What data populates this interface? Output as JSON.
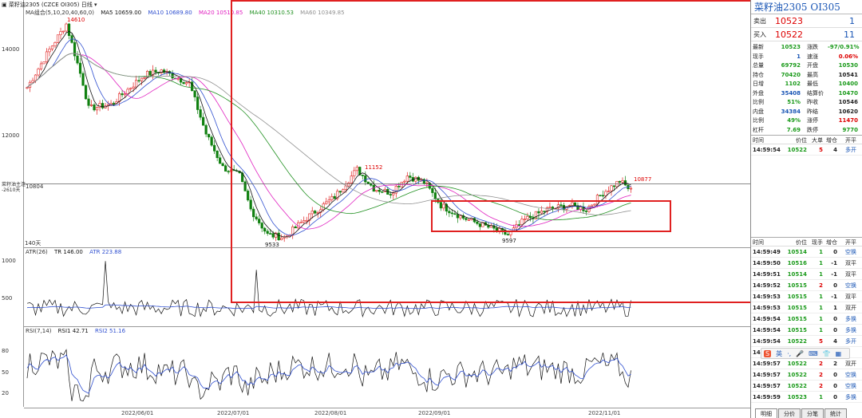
{
  "title_bar": {
    "text": "菜籽油2305 (CZCE OI305)",
    "period": "日线"
  },
  "ma_legend": {
    "label": "MA组合(5,10,20,40,60,0)",
    "ma5": "MA5 10659.00",
    "ma10": "MA10 10689.80",
    "ma20": "MA20 10510.85",
    "ma40": "MA40 10310.53",
    "ma60": "MA60 10349.85"
  },
  "colors": {
    "ma5": "#111111",
    "ma10": "#3050d0",
    "ma20": "#e020c0",
    "ma40": "#209020",
    "ma60": "#909090",
    "up": "#e02020",
    "down": "#108010",
    "box": "#e02020"
  },
  "price_axis": {
    "labels": [
      "14000",
      "12000",
      "10804"
    ],
    "cursor_label": "菜籽油主连",
    "cursor_sub": "-2610天",
    "days_label": "140天"
  },
  "annotations": {
    "high": "14610",
    "mid_high": "11152",
    "recent_high": "10877",
    "low1": "9533",
    "low2": "9597"
  },
  "atr_legend": {
    "label": "ATR(26)",
    "tr": "TR 146.00",
    "atr": "ATR 223.88",
    "axis": [
      "1000",
      "500"
    ]
  },
  "rsi_legend": {
    "label": "RSI(7,14)",
    "rsi1": "RSI1 42.71",
    "rsi2": "RSI2 51.16",
    "axis": [
      "80",
      "50",
      "20"
    ]
  },
  "dates": [
    "2022/06/01",
    "2022/07/01",
    "2022/08/01",
    "2022/09/01",
    "2022/11/01"
  ],
  "sidebar": {
    "title": "菜籽油2305  OI305",
    "sell": {
      "label": "卖出",
      "price": "10523",
      "vol": "1"
    },
    "buy": {
      "label": "买入",
      "price": "10522",
      "vol": "11"
    },
    "quote": [
      {
        "k": "最新",
        "v": "10523",
        "k2": "涨跌",
        "v2": "-97/0.91%"
      },
      {
        "k": "现手",
        "v": "1",
        "k2": "速涨",
        "v2": "0.06%"
      },
      {
        "k": "总量",
        "v": "69792",
        "k2": "开盘",
        "v2": "10530"
      },
      {
        "k": "持仓",
        "v": "70420",
        "k2": "最高",
        "v2": "10541"
      },
      {
        "k": "日增",
        "v": "1102",
        "k2": "最低",
        "v2": "10400"
      },
      {
        "k": "外盘",
        "v": "35408",
        "k2": "结算价",
        "v2": "10470"
      },
      {
        "k": "比例",
        "v": "51%",
        "k2": "昨收",
        "v2": "10546"
      },
      {
        "k": "内盘",
        "v": "34384",
        "k2": "昨结",
        "v2": "10620"
      },
      {
        "k": "比例",
        "v": "49%",
        "k2": "涨停",
        "v2": "11470"
      },
      {
        "k": "杠杆",
        "v": "7.69",
        "k2": "跌停",
        "v2": "9770"
      }
    ],
    "big_head": [
      "时间",
      "价位",
      "大单",
      "增仓",
      "开平"
    ],
    "big_rows": [
      {
        "t": "14:59:54",
        "p": "10522",
        "a": "5",
        "b": "4",
        "c": "多开"
      }
    ],
    "trade_head": [
      "时间",
      "价位",
      "现手",
      "增仓",
      "开平"
    ],
    "trades": [
      {
        "t": "14:59:49",
        "p": "10514",
        "a": "1",
        "b": "0",
        "c": "空换"
      },
      {
        "t": "14:59:50",
        "p": "10516",
        "a": "1",
        "b": "-1",
        "c": "双平"
      },
      {
        "t": "14:59:51",
        "p": "10514",
        "a": "1",
        "b": "-1",
        "c": "双平"
      },
      {
        "t": "14:59:52",
        "p": "10515",
        "a": "2",
        "b": "0",
        "c": "空换"
      },
      {
        "t": "14:59:53",
        "p": "10515",
        "a": "1",
        "b": "-1",
        "c": "双平"
      },
      {
        "t": "14:59:53",
        "p": "10515",
        "a": "1",
        "b": "1",
        "c": "双开"
      },
      {
        "t": "14:59:54",
        "p": "10515",
        "a": "1",
        "b": "0",
        "c": "多换"
      },
      {
        "t": "14:59:54",
        "p": "10515",
        "a": "1",
        "b": "0",
        "c": "多换"
      },
      {
        "t": "14:59:54",
        "p": "10522",
        "a": "5",
        "b": "4",
        "c": "多开"
      },
      {
        "t": "14:59:55",
        "p": "",
        "a": "",
        "b": "",
        "c": ""
      },
      {
        "t": "14:59:57",
        "p": "10522",
        "a": "2",
        "b": "2",
        "c": "双开"
      },
      {
        "t": "14:59:57",
        "p": "10522",
        "a": "2",
        "b": "0",
        "c": "空换"
      },
      {
        "t": "14:59:57",
        "p": "10522",
        "a": "2",
        "b": "0",
        "c": "空换"
      },
      {
        "t": "14:59:59",
        "p": "10523",
        "a": "1",
        "b": "0",
        "c": "多换"
      }
    ],
    "tabs": [
      "明细",
      "分价",
      "分笔",
      "统计"
    ]
  },
  "chart_data": {
    "type": "candlestick",
    "title": "菜籽油2305 (CZCE OI305)",
    "x_labels": [
      "2022/06/01",
      "2022/07/01",
      "2022/08/01",
      "2022/09/01",
      "2022/11/01"
    ],
    "ylim": [
      9300,
      14800
    ],
    "annotated_points": {
      "high": 14610,
      "mid_high": 11152,
      "recent_high": 10877,
      "low1": 9533,
      "low2": 9597,
      "current_line": 10804
    },
    "ma_last": {
      "MA5": 10659.0,
      "MA10": 10689.8,
      "MA20": 10510.85,
      "MA40": 10310.53,
      "MA60": 10349.85
    },
    "atr_last": {
      "TR": 146.0,
      "ATR": 223.88
    },
    "rsi_last": {
      "RSI1": 42.71,
      "RSI2": 51.16
    }
  }
}
